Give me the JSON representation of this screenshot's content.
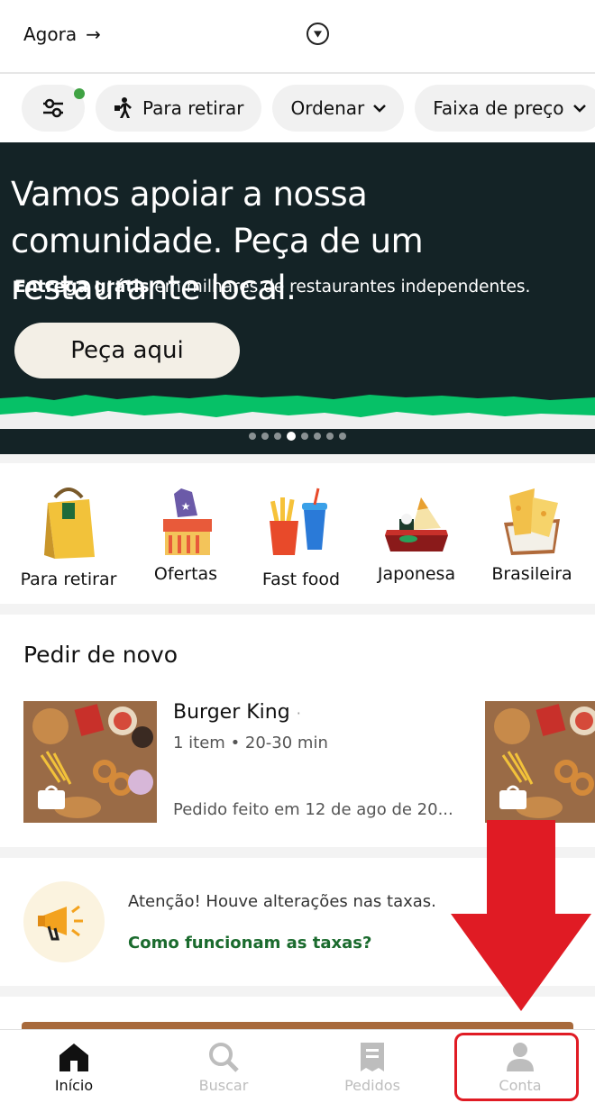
{
  "header": {
    "time_label": "Agora",
    "time_arrow": "→"
  },
  "filters": {
    "pickup": "Para retirar",
    "sort": "Ordenar",
    "price": "Faixa de preço"
  },
  "banner": {
    "headline": "Vamos apoiar a nossa comunidade. Peça de um restaurante local.",
    "sub_bold": "Entrega grátis",
    "sub_rest": " em milhares de restaurantes independentes.",
    "cta": "Peça aqui",
    "slides_total": 8,
    "slide_active": 4
  },
  "categories": [
    {
      "label": "Para retirar",
      "icon": "shopping-bag-icon"
    },
    {
      "label": "Ofertas",
      "icon": "deals-tag-icon"
    },
    {
      "label": "Fast food",
      "icon": "fries-soda-icon"
    },
    {
      "label": "Japonesa",
      "icon": "sushi-icon"
    },
    {
      "label": "Brasileira",
      "icon": "pastel-icon"
    }
  ],
  "reorder": {
    "title": "Pedir de novo",
    "restaurant": "Burger King",
    "separator": "·",
    "meta": "1 item • 20-30 min",
    "date": "Pedido feito em 12 de ago de 20..."
  },
  "notice": {
    "text": "Atenção! Houve alterações nas taxas.",
    "link": "Como funcionam as taxas?"
  },
  "nav": [
    {
      "label": "Início",
      "icon": "home-icon",
      "active": true
    },
    {
      "label": "Buscar",
      "icon": "search-icon",
      "active": false
    },
    {
      "label": "Pedidos",
      "icon": "receipt-icon",
      "active": false
    },
    {
      "label": "Conta",
      "icon": "account-icon",
      "active": false
    }
  ],
  "colors": {
    "banner_bg": "#142326",
    "brand_green": "#06c167",
    "link_green": "#1b6b2e",
    "annotation_red": "#e01b24"
  }
}
